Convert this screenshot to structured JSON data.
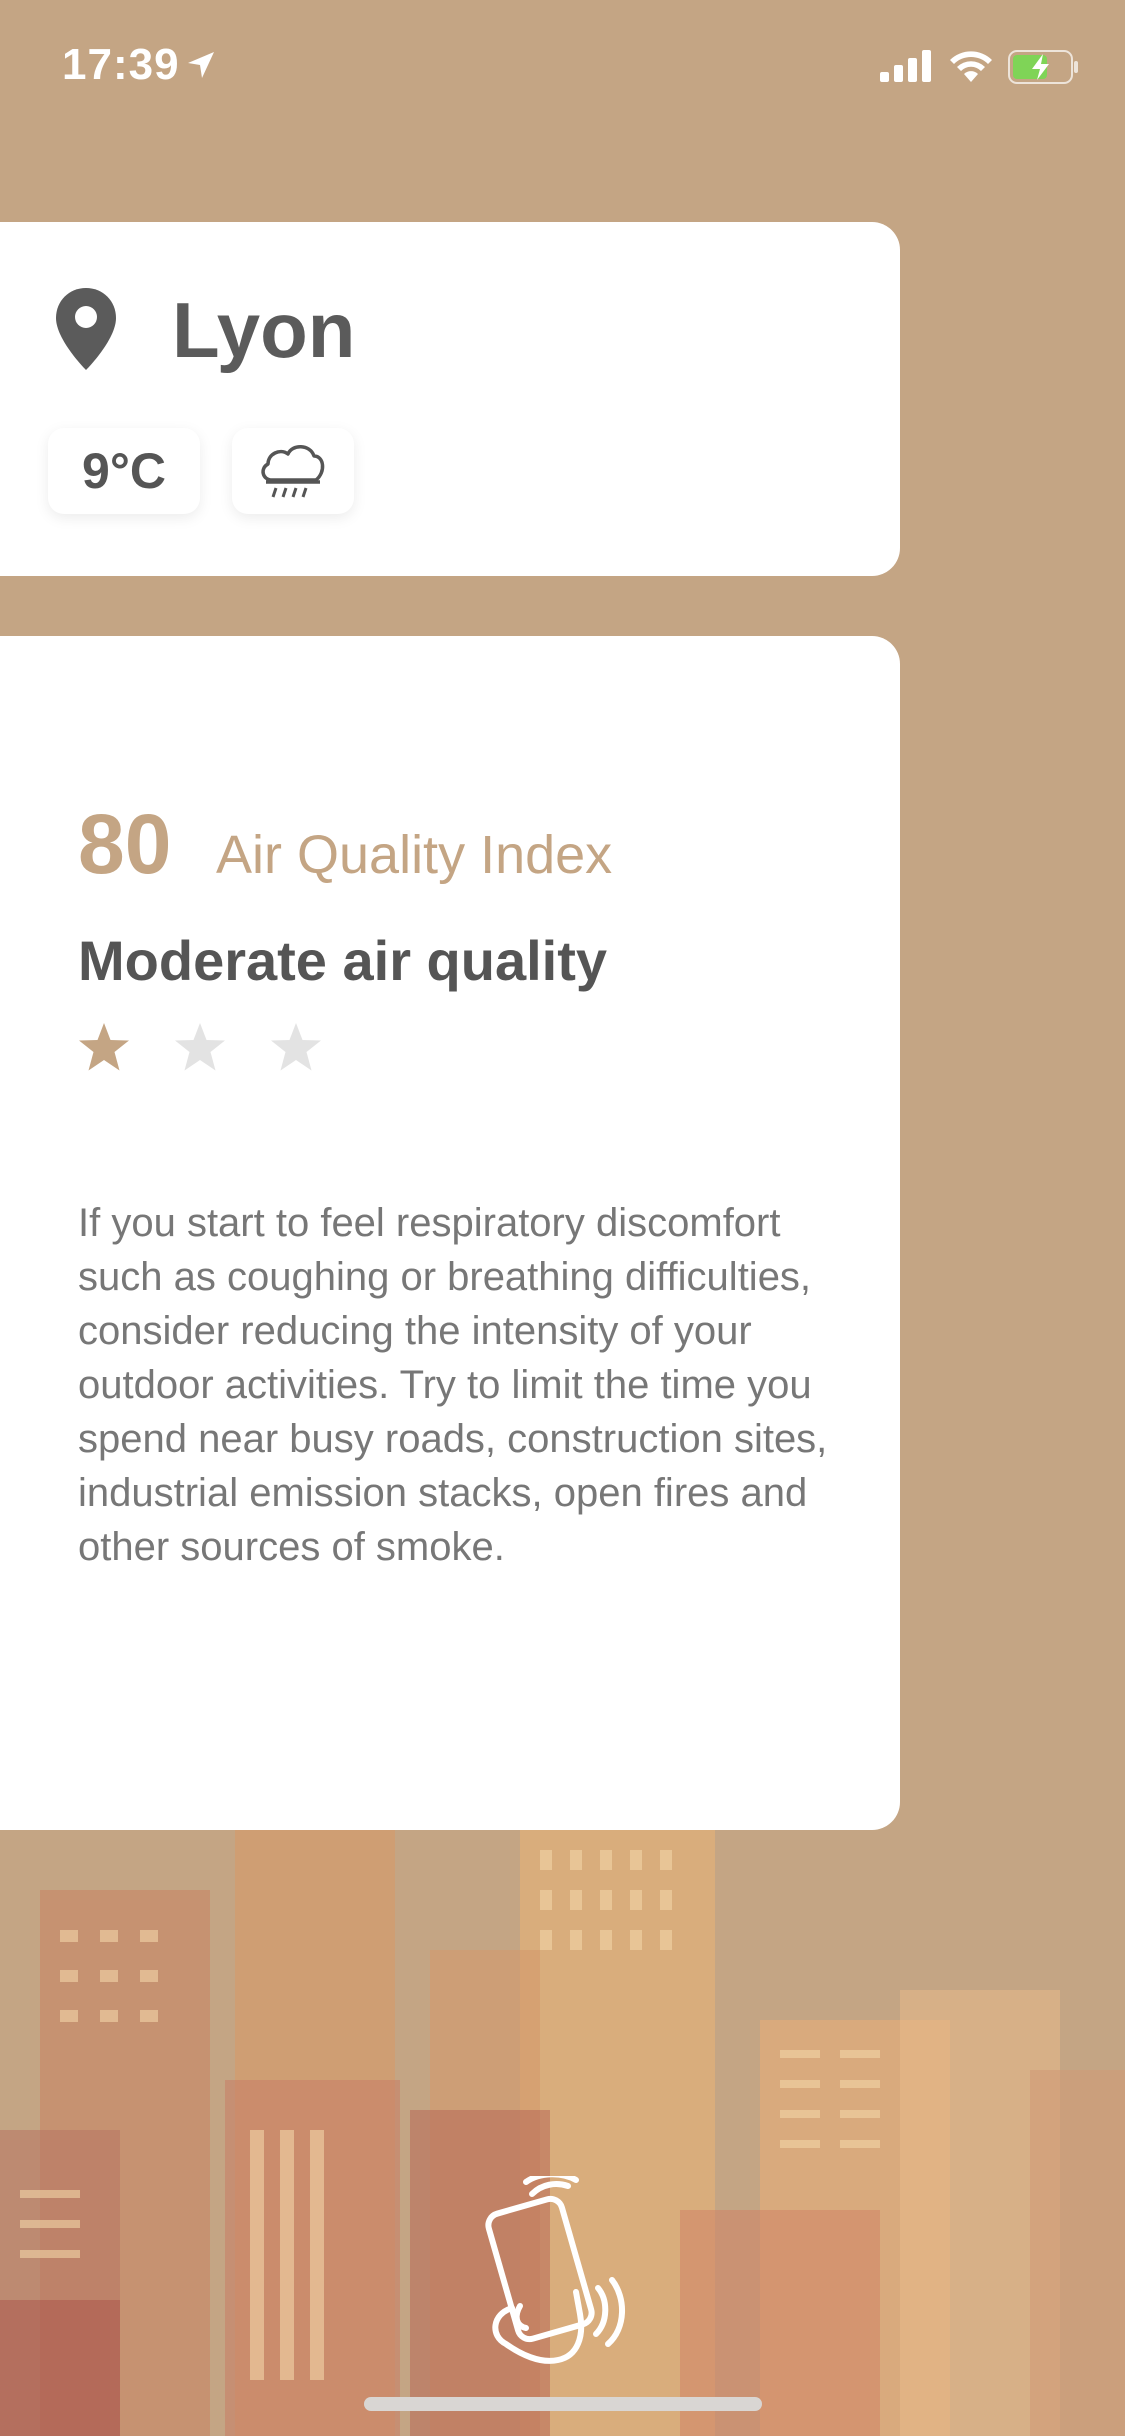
{
  "status_bar": {
    "time": "17:39",
    "icons": [
      "location-arrow-icon",
      "cellular-signal-icon",
      "wifi-icon",
      "battery-charging-icon"
    ],
    "battery_color": "#7fd457"
  },
  "location_card": {
    "city": "Lyon",
    "temperature": "9°C",
    "weather_icon": "rain-cloud-icon"
  },
  "aqi_card": {
    "aqi_value": "80",
    "aqi_label": "Air Quality Index",
    "quality_text": "Moderate air quality",
    "rating": 1,
    "rating_max": 3,
    "advice": "If you start to feel respiratory discomfort such as coughing or breathing difficulties, consider reducing the intensity of your outdoor activities. Try to limit the time you spend near busy roads, construction sites, industrial emission stacks, open fires and other sources of smoke."
  },
  "theme": {
    "accent": "#c4a584",
    "star_active": "#c4a584",
    "star_inactive": "#e3e3e3",
    "text_dark": "#555555"
  },
  "bottom": {
    "gesture_icon": "shake-phone-icon"
  }
}
